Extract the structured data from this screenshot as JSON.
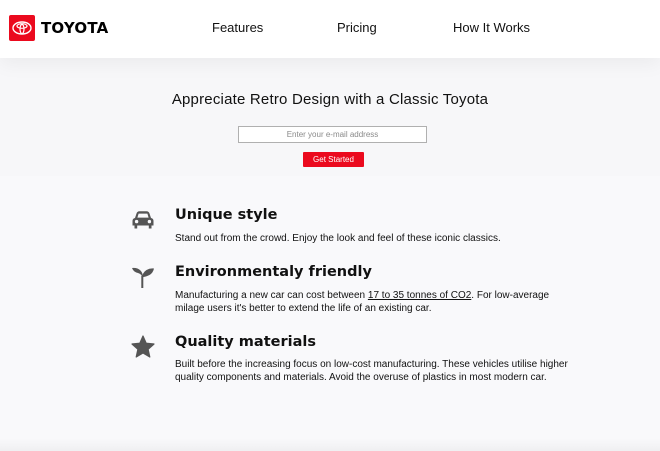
{
  "brand": {
    "name": "TOYOTA",
    "color": "#eb0a1e"
  },
  "nav": {
    "items": [
      "Features",
      "Pricing",
      "How It Works"
    ]
  },
  "hero": {
    "title": "Appreciate Retro Design with a Classic Toyota",
    "email_placeholder": "Enter your e-mail address",
    "cta_label": "Get Started"
  },
  "features": [
    {
      "icon": "car-icon",
      "title": "Unique style",
      "description": "Stand out from the crowd. Enjoy the look and feel of these iconic classics."
    },
    {
      "icon": "seedling-icon",
      "title": "Environmentaly friendly",
      "description_before": "Manufacturing a new car can cost between ",
      "link_text": "17 to 35 tonnes of CO2",
      "description_after": ". For low-average milage users it's better to extend the life of an existing car."
    },
    {
      "icon": "star-icon",
      "title": "Quality materials",
      "description": "Built before the increasing focus on low-cost manufacturing. These vehicles utilise higher quality components and materials. Avoid the overuse of plastics in most modern car."
    }
  ]
}
